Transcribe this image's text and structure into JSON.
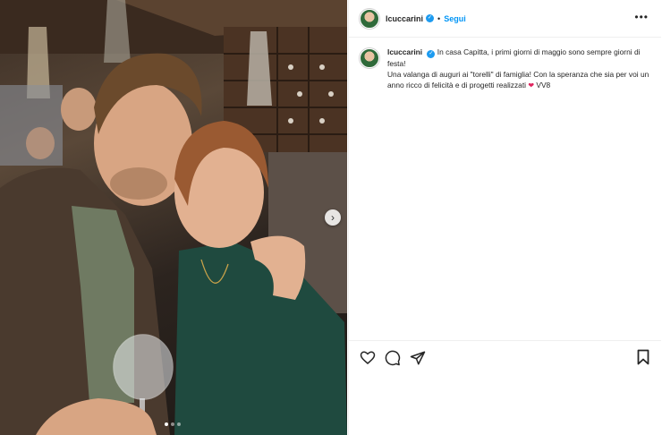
{
  "post": {
    "username": "lcuccarini",
    "separator": "•",
    "follow_label": "Segui",
    "more_label": "•••",
    "caption_line1": "In casa Capitta, i primi giorni di maggio sono sempre giorni di festa!",
    "caption_line2": "Una valanga di auguri ai \"torelli\" di famiglia! Con la speranza che sia per voi un anno ricco di felicità e di progetti realizzati",
    "caption_end": "VV8",
    "heart_emoji": "❤",
    "verified_icon": "✓",
    "next_icon": "›"
  },
  "colors": {
    "accent": "#0095f6",
    "verified": "#1d9bf0",
    "heart": "#e0245e"
  },
  "carousel": {
    "slides": 3,
    "active": 1
  }
}
